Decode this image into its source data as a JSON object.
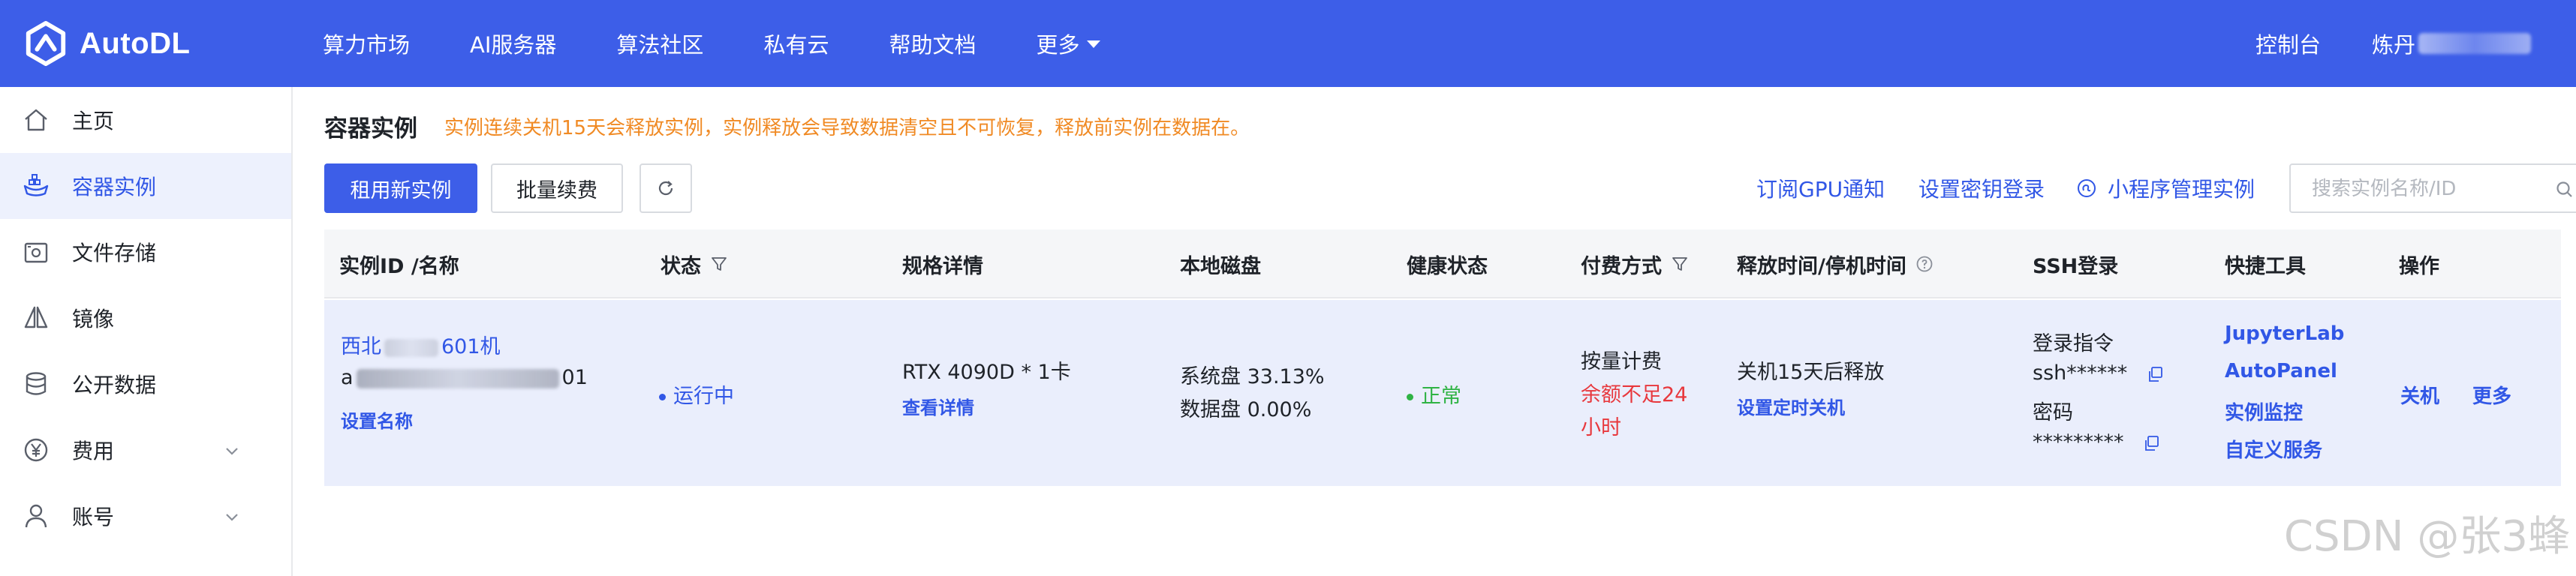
{
  "brand": {
    "name": "AutoDL"
  },
  "nav": {
    "items": [
      "算力市场",
      "AI服务器",
      "算法社区",
      "私有云",
      "帮助文档"
    ],
    "more": "更多",
    "console": "控制台",
    "user_prefix": "炼丹"
  },
  "sidebar": {
    "items": [
      {
        "label": "主页",
        "icon": "home-icon"
      },
      {
        "label": "容器实例",
        "icon": "container-icon"
      },
      {
        "label": "文件存储",
        "icon": "file-storage-icon"
      },
      {
        "label": "镜像",
        "icon": "image-icon"
      },
      {
        "label": "公开数据",
        "icon": "database-icon"
      },
      {
        "label": "费用",
        "icon": "yen-icon"
      },
      {
        "label": "账号",
        "icon": "user-icon"
      }
    ],
    "active_index": 1
  },
  "page": {
    "title": "容器实例",
    "warning": "实例连续关机15天会释放实例，实例释放会导致数据清空且不可恢复，释放前实例在数据在。"
  },
  "toolbar": {
    "new_instance": "租用新实例",
    "batch_renew": "批量续费",
    "subscribe_gpu": "订阅GPU通知",
    "ssh_key_login": "设置密钥登录",
    "mini_program": "小程序管理实例",
    "search_placeholder": "搜索实例名称/ID"
  },
  "table": {
    "headers": {
      "id_name": "实例ID /名称",
      "status": "状态",
      "spec": "规格详情",
      "disk": "本地磁盘",
      "health": "健康状态",
      "billing": "付费方式",
      "release": "释放时间/停机时间",
      "ssh": "SSH登录",
      "tools": "快捷工具",
      "ops": "操作"
    },
    "row": {
      "region_prefix": "西北",
      "region_suffix": "601机",
      "id_prefix": "a",
      "id_suffix": "01",
      "set_name": "设置名称",
      "status": "运行中",
      "spec": "RTX 4090D * 1卡",
      "spec_detail": "查看详情",
      "system_disk": "系统盘 33.13%",
      "data_disk": "数据盘 0.00%",
      "health": "正常",
      "billing_type": "按量计费",
      "billing_warning_line1": "余额不足24",
      "billing_warning_line2": "小时",
      "release_text": "关机15天后释放",
      "set_shutdown": "设置定时关机",
      "login_cmd_label": "登录指令",
      "login_cmd": "ssh******",
      "password_label": "密码",
      "password": "*********",
      "tools": [
        "JupyterLab",
        "AutoPanel",
        "实例监控",
        "自定义服务"
      ],
      "shutdown": "关机",
      "more": "更多"
    }
  },
  "watermark": "CSDN @张3蜂",
  "colors": {
    "header_bg": "#3d5ee8",
    "link": "#3157e6",
    "warning": "#f08a24",
    "danger": "#e8383d",
    "success": "#2fb344",
    "row_highlight": "#eaeefc"
  }
}
